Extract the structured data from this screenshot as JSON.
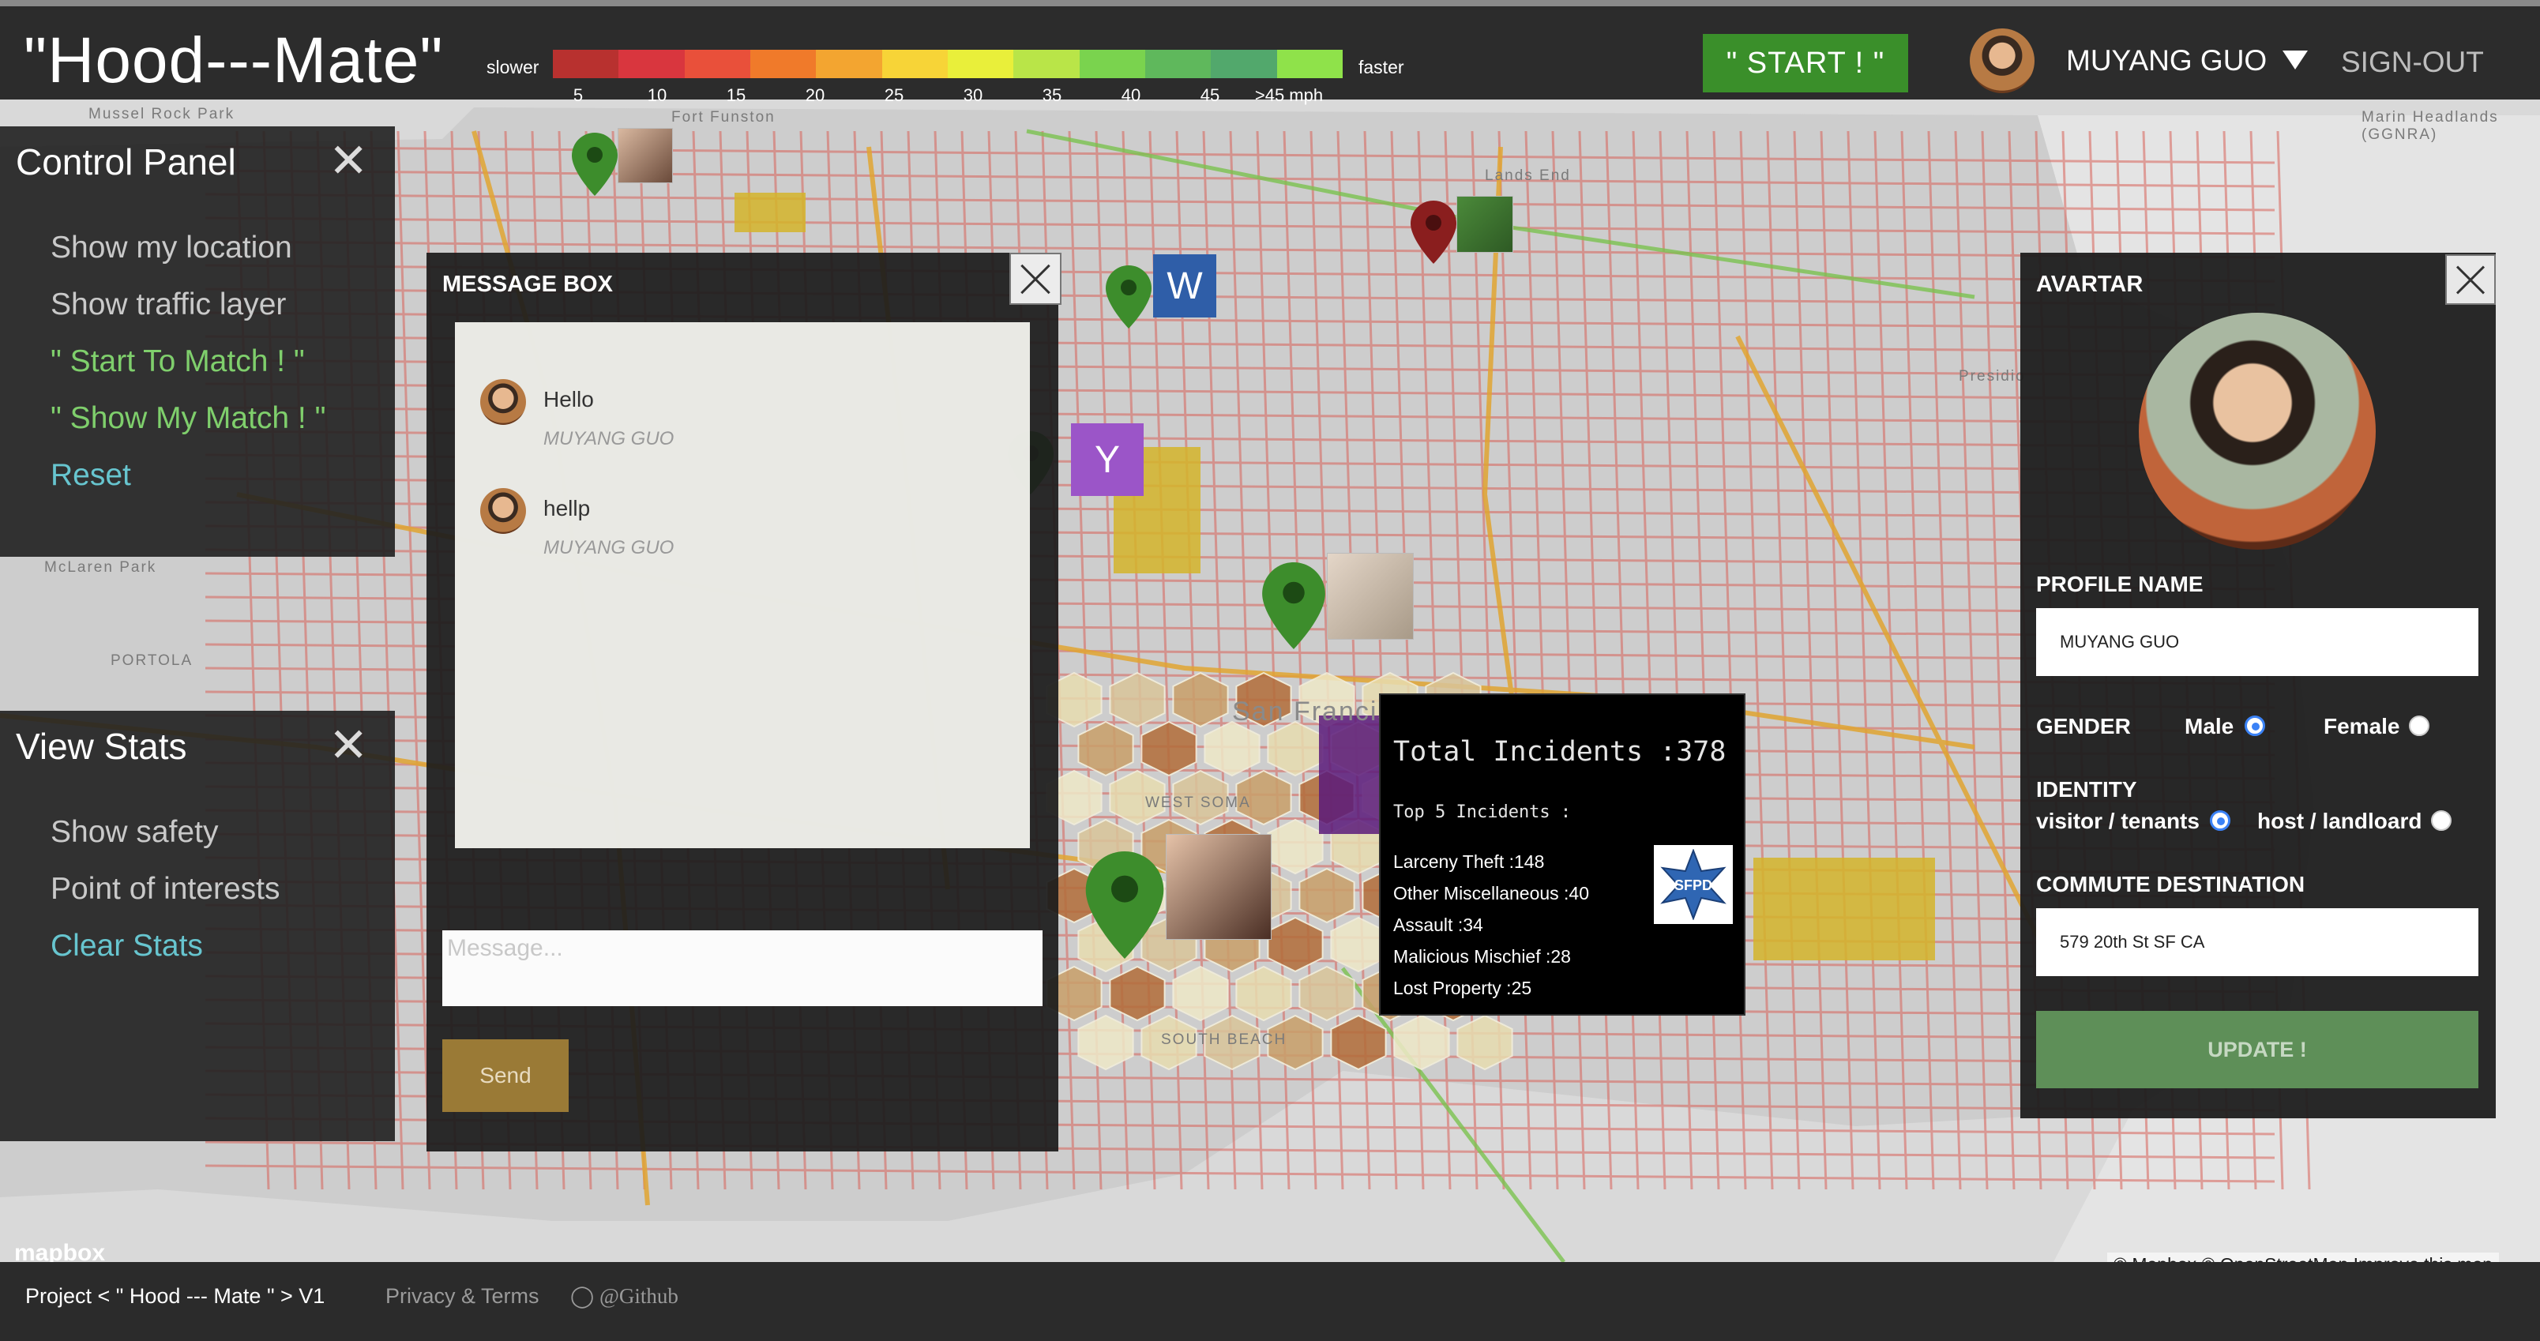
{
  "app": {
    "title": "\"Hood---Mate\""
  },
  "traffic_legend": {
    "slower": "slower",
    "faster": "faster",
    "segments": [
      "#b8312f",
      "#d9363e",
      "#e9503a",
      "#f07a2a",
      "#f3a530",
      "#f7d437",
      "#e9ef3a",
      "#b9e548",
      "#7ad34e",
      "#5fb85c",
      "#52a86c",
      "#8fe24a"
    ],
    "ticks": [
      "5",
      "10",
      "15",
      "20",
      "25",
      "30",
      "35",
      "40",
      "45",
      ">45 mph"
    ]
  },
  "header": {
    "start_label": "\" START ! \"",
    "user_name": "MUYANG GUO",
    "signout_label": "SIGN-OUT"
  },
  "control_panel": {
    "title": "Control Panel",
    "items": [
      {
        "label": "Show my location"
      },
      {
        "label": "Show traffic layer"
      },
      {
        "label": "\" Start To Match ! \""
      },
      {
        "label": "\" Show My Match ! \""
      },
      {
        "label": "Reset"
      }
    ]
  },
  "view_stats": {
    "title": "View Stats",
    "items": [
      {
        "label": "Show safety"
      },
      {
        "label": "Point of interests"
      },
      {
        "label": "Clear Stats"
      }
    ]
  },
  "message_box": {
    "title": "MESSAGE BOX",
    "messages": [
      {
        "text": "Hello",
        "author": "MUYANG GUO"
      },
      {
        "text": "hellp",
        "author": "MUYANG GUO"
      }
    ],
    "input_placeholder": "Message...",
    "send_label": "Send"
  },
  "incidents": {
    "total": "Total Incidents :378",
    "top_label": "Top 5 Incidents :",
    "rows": [
      "Larceny Theft :148",
      "Other Miscellaneous :40",
      "Assault :34",
      "Malicious Mischief :28",
      "Lost Property :25"
    ],
    "badge_text": "SFPD"
  },
  "avatar_panel": {
    "title": "AVARTAR",
    "profile_name_label": "PROFILE NAME",
    "profile_name_value": "MUYANG GUO",
    "gender_label": "GENDER",
    "gender_options": [
      "Male",
      "Female"
    ],
    "gender_selected": "Male",
    "identity_label": "IDENTITY",
    "identity_options": [
      "visitor / tenants",
      "host / landloard"
    ],
    "identity_selected": "visitor / tenants",
    "commute_label": "COMMUTE DESTINATION",
    "commute_value": "579 20th St SF CA",
    "update_label": "UPDATE !"
  },
  "map": {
    "labels": {
      "mussel_rock": "Mussel Rock Park",
      "fort_funston": "Fort Funston",
      "mclaren": "McLaren Park",
      "portola": "PORTOLA",
      "west_soma": "WEST SOMA",
      "south_beach": "SOUTH BEACH",
      "marin": "Marin Headlands (GGNRA)",
      "lands_end": "Lands End",
      "presidio": "Presidio",
      "san_francisco": "San Francisco"
    },
    "tiles": [
      "W",
      "Y"
    ],
    "mapbox_logo": "mapbox",
    "attribution": "© Mapbox © OpenStreetMap  Improve this map"
  },
  "footer": {
    "project": "Project < \" Hood --- Mate \" > V1",
    "privacy": "Privacy & Terms",
    "github": "@Github"
  }
}
